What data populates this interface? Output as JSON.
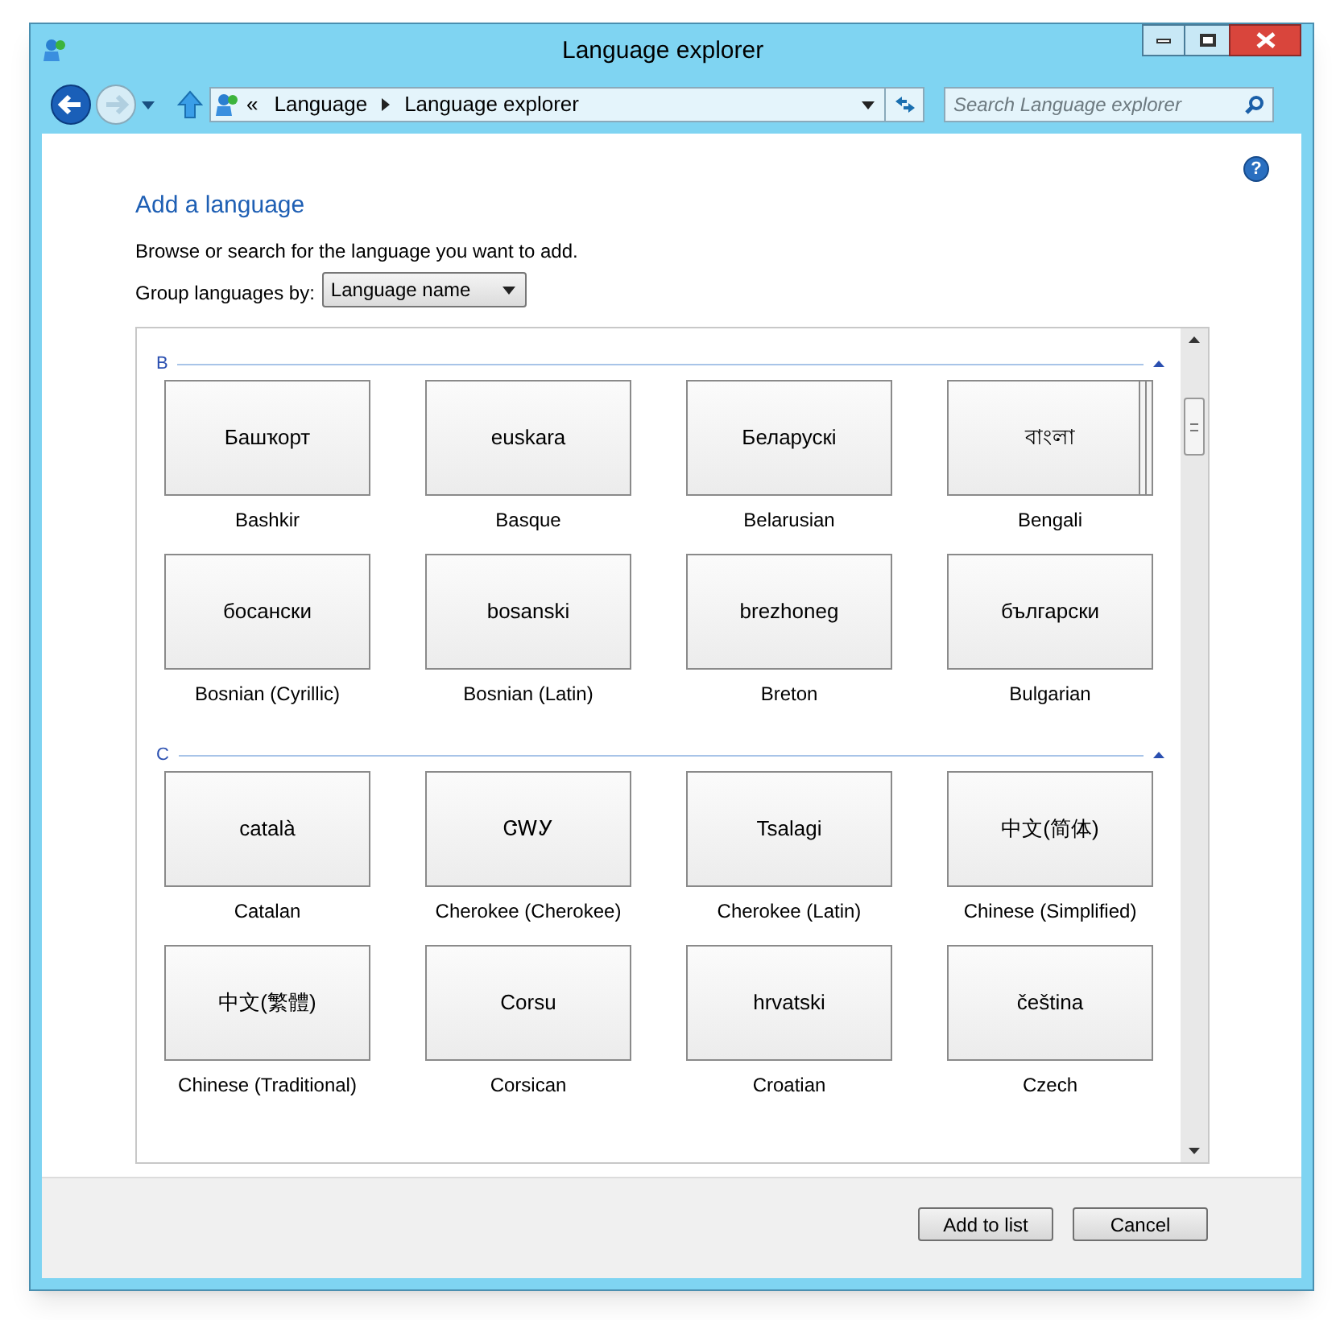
{
  "window": {
    "title": "Language explorer"
  },
  "address_bar": {
    "overflow": "«",
    "path": [
      "Language",
      "Language explorer"
    ]
  },
  "search": {
    "placeholder": "Search Language explorer"
  },
  "help": "?",
  "heading": "Add a language",
  "instructions": "Browse or search for the language you want to add.",
  "group_by": {
    "label": "Group languages by:",
    "value": "Language name"
  },
  "groups": [
    {
      "letter": "B",
      "expanded": true,
      "languages": [
        {
          "native": "Башҡорт",
          "name": "Bashkir",
          "stacked": false
        },
        {
          "native": "euskara",
          "name": "Basque",
          "stacked": false
        },
        {
          "native": "Беларускі",
          "name": "Belarusian",
          "stacked": false
        },
        {
          "native": "বাংলা",
          "name": "Bengali",
          "stacked": true
        },
        {
          "native": "босански",
          "name": "Bosnian (Cyrillic)",
          "stacked": false
        },
        {
          "native": "bosanski",
          "name": "Bosnian (Latin)",
          "stacked": false
        },
        {
          "native": "brezhoneg",
          "name": "Breton",
          "stacked": false
        },
        {
          "native": "български",
          "name": "Bulgarian",
          "stacked": false
        }
      ]
    },
    {
      "letter": "C",
      "expanded": true,
      "languages": [
        {
          "native": "català",
          "name": "Catalan",
          "stacked": false
        },
        {
          "native": "ᏣᎳᎩ",
          "name": "Cherokee (Cherokee)",
          "stacked": false
        },
        {
          "native": "Tsalagi",
          "name": "Cherokee (Latin)",
          "stacked": false
        },
        {
          "native": "中文(简体)",
          "name": "Chinese (Simplified)",
          "stacked": false
        },
        {
          "native": "中文(繁體)",
          "name": "Chinese (Traditional)",
          "stacked": false
        },
        {
          "native": "Corsu",
          "name": "Corsican",
          "stacked": false
        },
        {
          "native": "hrvatski",
          "name": "Croatian",
          "stacked": false
        },
        {
          "native": "čeština",
          "name": "Czech",
          "stacked": false
        }
      ]
    }
  ],
  "buttons": [
    "Add to list",
    "Cancel"
  ]
}
